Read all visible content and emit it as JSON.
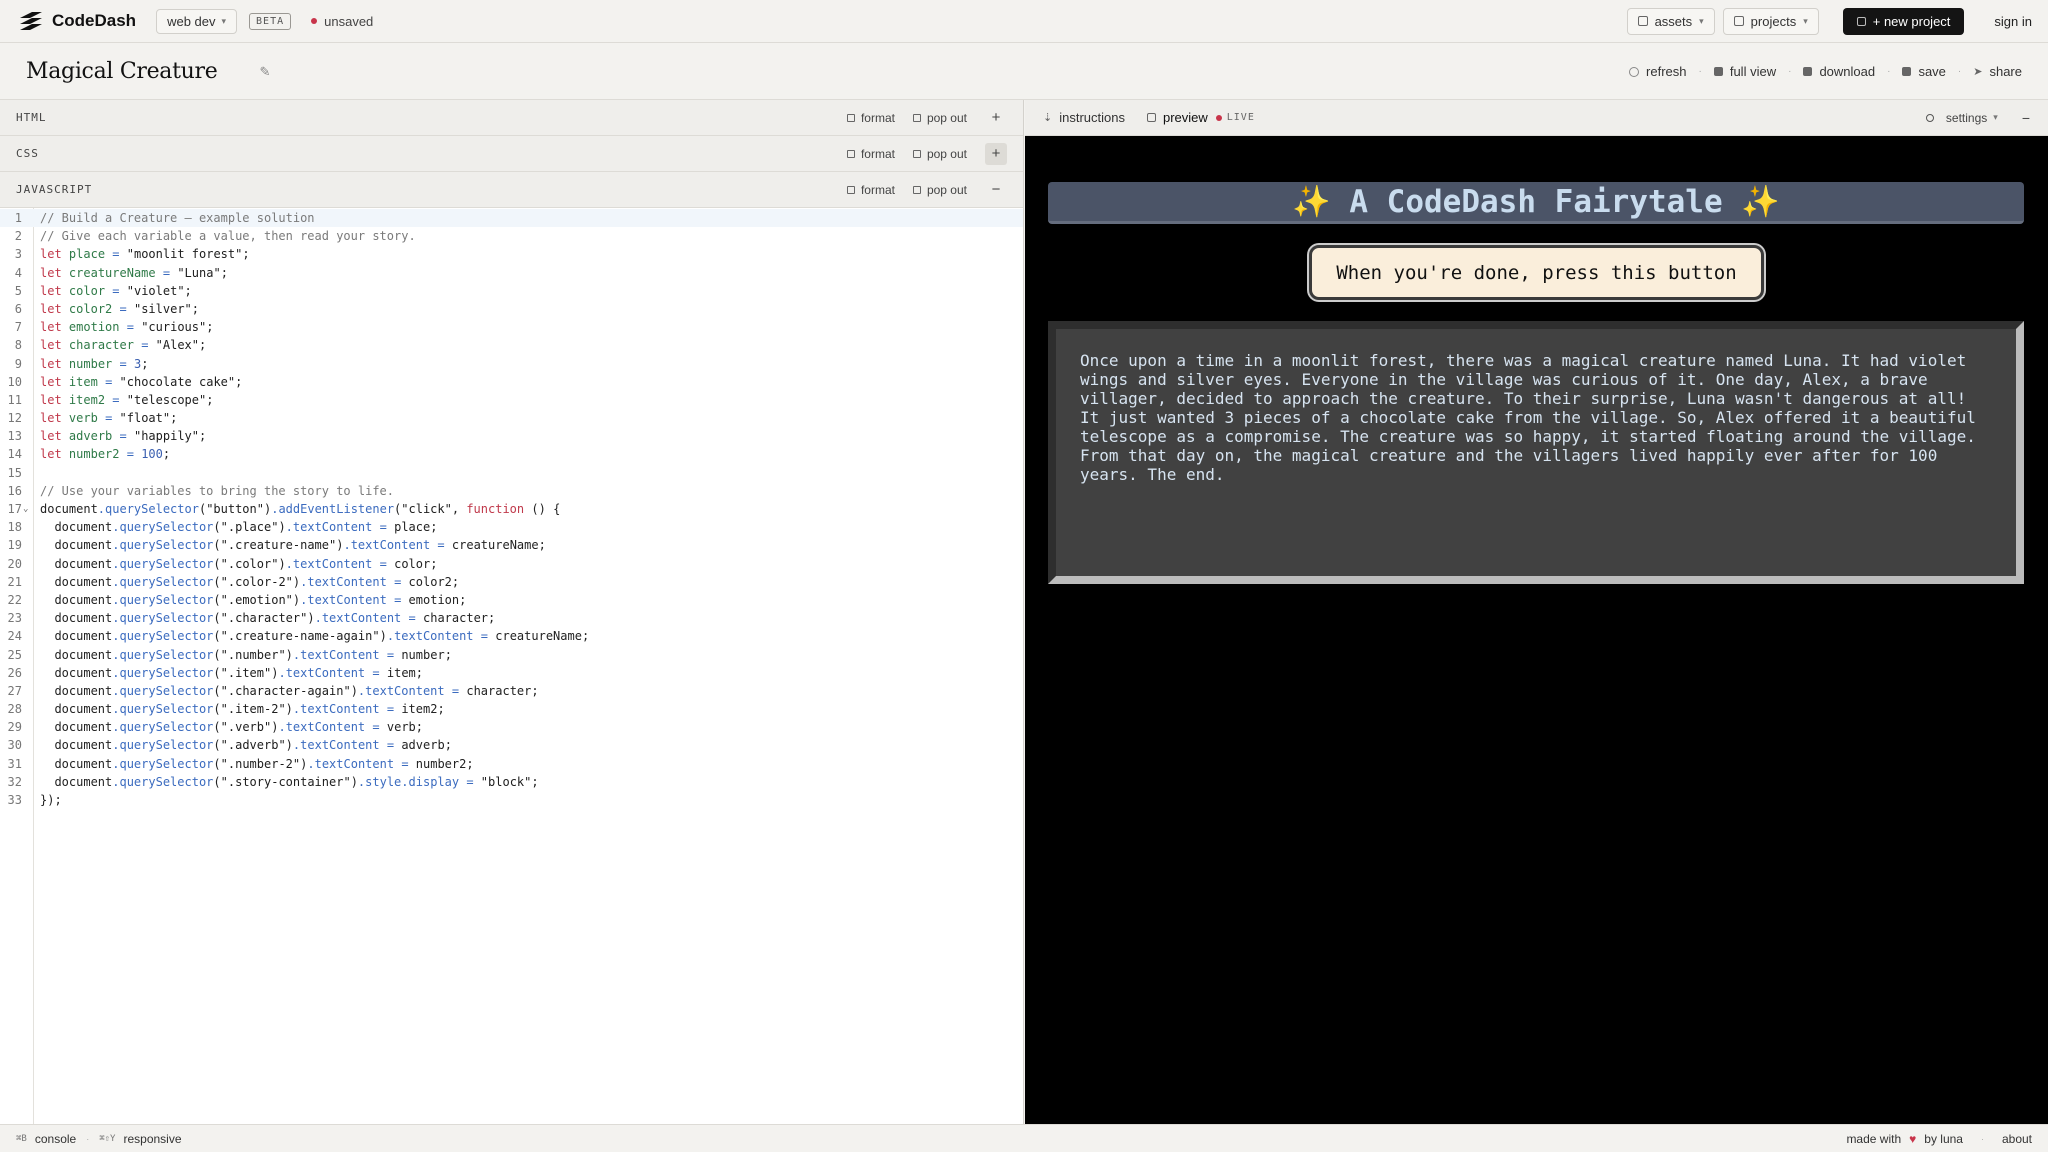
{
  "app": {
    "name": "CodeDash",
    "mode": "web dev",
    "badge": "BETA",
    "status": "unsaved"
  },
  "topbar": {
    "assets": "assets",
    "projects": "projects",
    "new_project": "+ new project",
    "sign_in": "sign in"
  },
  "project": {
    "title": "Magical Creature"
  },
  "actions": {
    "refresh": "refresh",
    "full_view": "full view",
    "download": "download",
    "save": "save",
    "share": "share"
  },
  "panels": [
    {
      "name": "HTML",
      "format": "format",
      "pop_out": "pop out",
      "toggle": "+"
    },
    {
      "name": "CSS",
      "format": "format",
      "pop_out": "pop out",
      "toggle": "+"
    },
    {
      "name": "JAVASCRIPT",
      "format": "format",
      "pop_out": "pop out",
      "toggle": "−"
    }
  ],
  "code": {
    "lines": [
      "// Build a Creature — example solution",
      "// Give each variable a value, then read your story.",
      "let place = \"moonlit forest\";",
      "let creatureName = \"Luna\";",
      "let color = \"violet\";",
      "let color2 = \"silver\";",
      "let emotion = \"curious\";",
      "let character = \"Alex\";",
      "let number = 3;",
      "let item = \"chocolate cake\";",
      "let item2 = \"telescope\";",
      "let verb = \"float\";",
      "let adverb = \"happily\";",
      "let number2 = 100;",
      "",
      "// Use your variables to bring the story to life.",
      "document.querySelector(\"button\").addEventListener(\"click\", function () {",
      "  document.querySelector(\".place\").textContent = place;",
      "  document.querySelector(\".creature-name\").textContent = creatureName;",
      "  document.querySelector(\".color\").textContent = color;",
      "  document.querySelector(\".color-2\").textContent = color2;",
      "  document.querySelector(\".emotion\").textContent = emotion;",
      "  document.querySelector(\".character\").textContent = character;",
      "  document.querySelector(\".creature-name-again\").textContent = creatureName;",
      "  document.querySelector(\".number\").textContent = number;",
      "  document.querySelector(\".item\").textContent = item;",
      "  document.querySelector(\".character-again\").textContent = character;",
      "  document.querySelector(\".item-2\").textContent = item2;",
      "  document.querySelector(\".verb\").textContent = verb;",
      "  document.querySelector(\".adverb\").textContent = adverb;",
      "  document.querySelector(\".number-2\").textContent = number2;",
      "  document.querySelector(\".story-container\").style.display = \"block\";",
      "});"
    ]
  },
  "preview": {
    "tab_instructions": "instructions",
    "tab_preview": "preview",
    "live": "LIVE",
    "settings": "settings",
    "minimize": "−",
    "title": "✨ A CodeDash Fairytale ✨",
    "button": "When you're done, press this button",
    "story": "Once upon a time in a moonlit forest, there was a magical creature named Luna. It had violet wings and silver eyes. Everyone in the village was curious of it. One day, Alex, a brave villager, decided to approach the creature. To their surprise, Luna wasn't dangerous at all! It just wanted 3 pieces of a chocolate cake from the village. So, Alex offered it a beautiful telescope as a compromise. The creature was so happy, it started floating around the village. From that day on, the magical creature and the villagers lived happily ever after for 100 years. The end."
  },
  "statusbar": {
    "console_key": "⌘B",
    "console": "console",
    "responsive_key": "⌘⇧Y",
    "responsive": "responsive",
    "made_with": "made with",
    "heart": "♥",
    "by": "by luna",
    "about": "about"
  },
  "colors": {
    "accent_red": "#c8344a",
    "preview_bg": "#000000",
    "title_bar_bg": "#4b5467",
    "button_bg": "#faeedb",
    "story_bg": "#414141"
  }
}
